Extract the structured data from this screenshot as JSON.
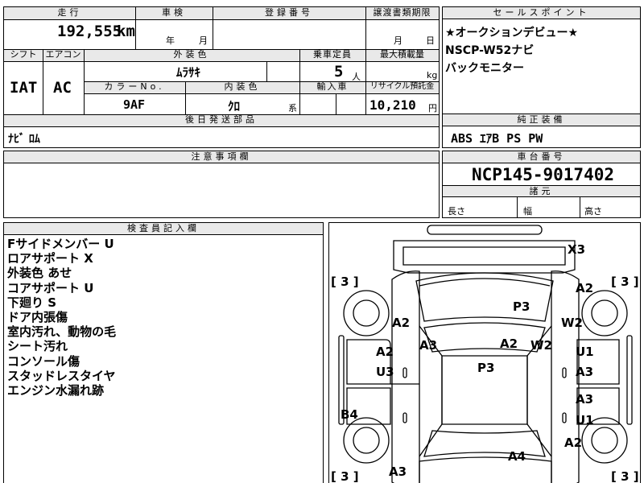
{
  "top": {
    "mileage_label": "走行",
    "mileage_value": "192,555",
    "mileage_unit": "km",
    "inspection_label": "車検",
    "inspection_year_unit": "年",
    "inspection_month_unit": "月",
    "registration_label": "登録番号",
    "transfer_label": "譲渡書類期限",
    "transfer_month_unit": "月",
    "transfer_day_unit": "日"
  },
  "specs": {
    "shift_label": "シフト",
    "shift_value": "IAT",
    "ac_label": "エアコン",
    "ac_value": "AC",
    "exterior_color_label": "外装色",
    "exterior_color_value": "ﾑﾗｻｷ",
    "capacity_label": "乗車定員",
    "capacity_value": "5",
    "capacity_unit": "人",
    "max_load_label": "最大積載量",
    "max_load_unit": "kg",
    "color_no_label": "カラーNo.",
    "color_no_value": "9AF",
    "interior_color_label": "内装色",
    "interior_color_value": "ｸﾛ",
    "interior_color_suffix": "系",
    "import_label": "輸入車",
    "recycle_label": "リサイクル預託金",
    "recycle_value": "10,210",
    "recycle_unit": "円"
  },
  "later_parts": {
    "label": "後日発送部品",
    "value": "ﾅﾋﾞ ﾛﾑ"
  },
  "notes": {
    "label": "注意事項欄"
  },
  "sales_points": {
    "label": "セールスポイント",
    "lines": [
      "★オークションデビュー★",
      "NSCP-W52ナビ",
      "バックモニター"
    ]
  },
  "genuine_equipment": {
    "label": "純正装備",
    "value": "ABS ｴｱB PS PW"
  },
  "chassis": {
    "label": "車台番号",
    "value": "NCP145-9017402"
  },
  "dimensions": {
    "label": "諸元",
    "length_label": "長さ",
    "width_label": "幅",
    "height_label": "高さ"
  },
  "inspector": {
    "label": "検査員記入欄",
    "remarks": [
      "Fサイドメンバー U",
      "ロアサポート X",
      "外装色 あせ",
      "コアサポート U",
      "下廻り S",
      "ドア内張傷",
      "室内汚れ、動物の毛",
      "シート汚れ",
      "コンソール傷",
      "スタッドレスタイヤ",
      "エンジン水漏れ跡"
    ]
  },
  "diagram": {
    "tire_bracket_front_left": "[ 3 ]",
    "tire_bracket_front_right": "[ 3 ]",
    "tire_bracket_rear_left": "[ 3 ]",
    "tire_bracket_rear_right": "[ 3 ]",
    "marks": {
      "front_bumper": "X3",
      "front_right_fender": "A2",
      "hood": "P3",
      "left_front_fender": "A2",
      "right_front_fender": "W2",
      "left_a_pillar": "A3",
      "windshield": "A2",
      "right_a_pillar": "W2",
      "left_front_door_1": "A2",
      "left_front_door_2": "U3",
      "roof": "P3",
      "right_front_door_1": "U1",
      "right_front_door_2": "A3",
      "right_rear_door_1": "A3",
      "right_rear_door_2": "U1",
      "left_rear_door": "B4",
      "right_rear_fender": "A2",
      "trunk": "A4",
      "left_rear_bumper": "A3"
    }
  }
}
